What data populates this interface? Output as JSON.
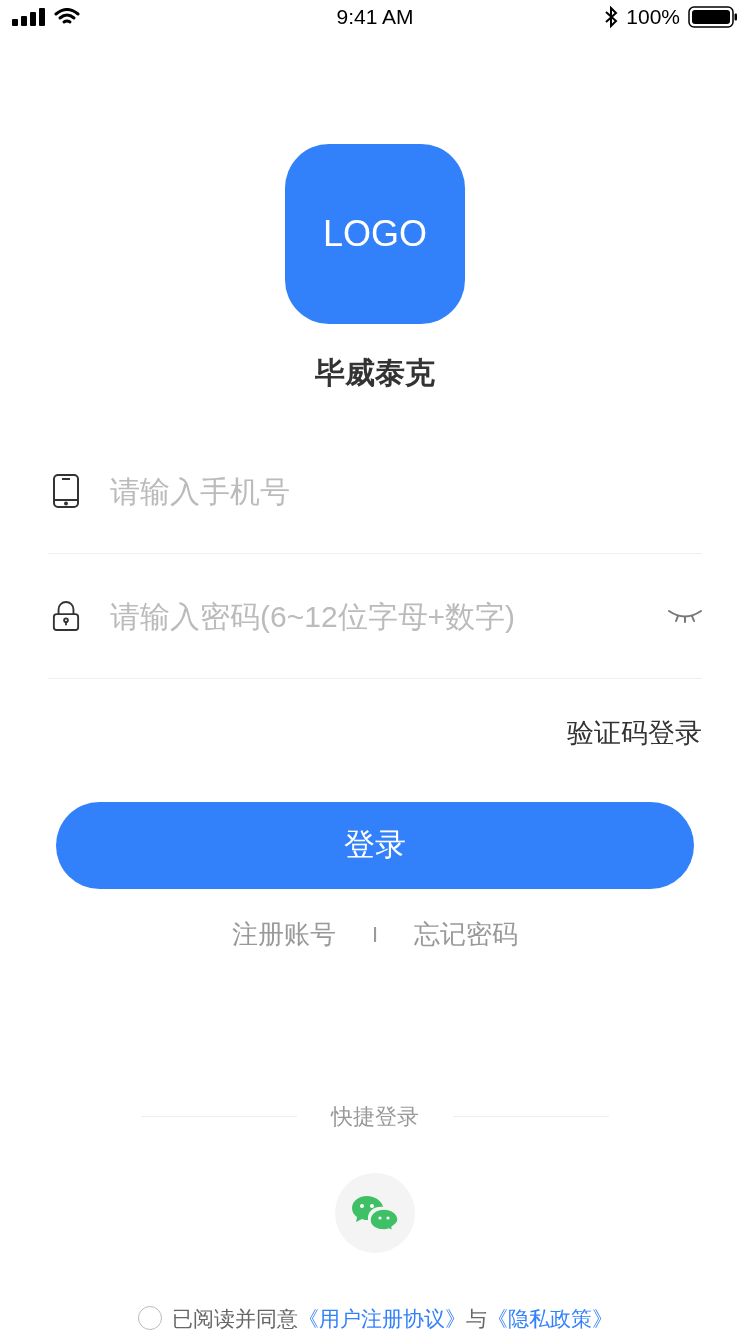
{
  "status_bar": {
    "time": "9:41 AM",
    "battery": "100%"
  },
  "logo": {
    "text": "LOGO"
  },
  "app_name": "毕威泰克",
  "fields": [
    {
      "kind": "phone",
      "placeholder": "请输入手机号"
    },
    {
      "kind": "password",
      "placeholder": "请输入密码(6~12位字母+数字)"
    }
  ],
  "sms_login_link": "验证码登录",
  "login_button": "登录",
  "links": [
    "注册账号",
    "忘记密码"
  ],
  "link_separator": "I",
  "quick_login": {
    "title": "快捷登录"
  },
  "agreement": {
    "checked": false,
    "prefix": "已阅读并同意",
    "terms_link": "《用户注册协议》",
    "conjunction": "与",
    "privacy_link": "《隐私政策》"
  }
}
